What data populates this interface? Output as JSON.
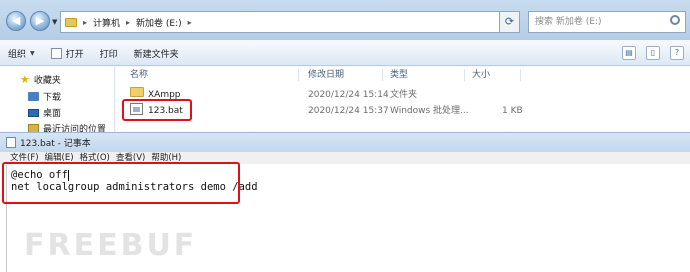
{
  "explorer": {
    "address_path": [
      "计算机",
      "新加卷 (E:)"
    ],
    "search_placeholder": "搜索 新加卷 (E:)",
    "toolbar": {
      "organize": "组织",
      "open": "打开",
      "print": "打印",
      "new_folder": "新建文件夹"
    },
    "sidebar": {
      "favorites": "收藏夹",
      "downloads": "下载",
      "desktop": "桌面",
      "recent": "最近访问的位置"
    },
    "columns": {
      "name": "名称",
      "modified": "修改日期",
      "type": "类型",
      "size": "大小"
    },
    "files": [
      {
        "name": "XAmpp",
        "modified": "2020/12/24 15:14",
        "type": "文件夹",
        "size": ""
      },
      {
        "name": "123.bat",
        "modified": "2020/12/24 15:37",
        "type": "Windows 批处理...",
        "size": "1 KB"
      }
    ]
  },
  "notepad": {
    "title": "123.bat - 记事本",
    "menu": [
      "文件(F)",
      "编辑(E)",
      "格式(O)",
      "查看(V)",
      "帮助(H)"
    ],
    "content_lines": [
      "@echo off",
      "net localgroup administrators demo /add"
    ]
  },
  "watermark": "FREEBUF",
  "colors": {
    "highlight_red": "#e0101a",
    "window_blue": "#c3d7ec"
  }
}
